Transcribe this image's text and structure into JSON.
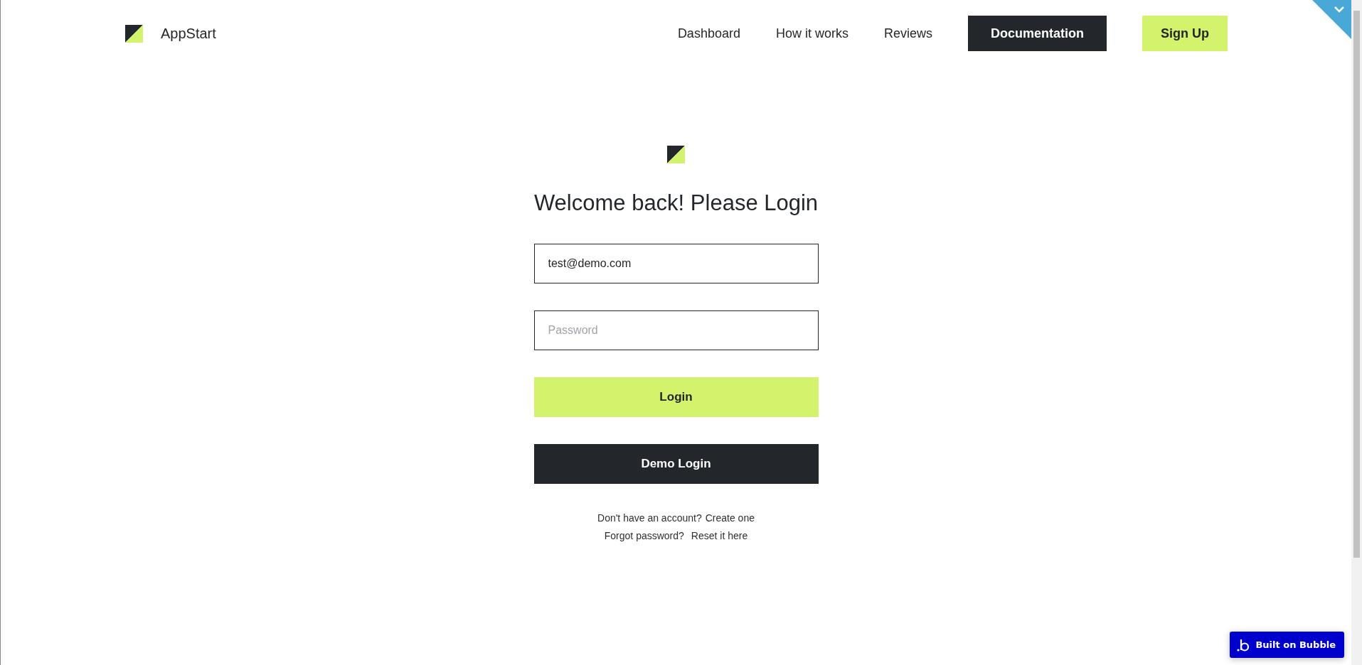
{
  "header": {
    "brand": "AppStart",
    "nav": [
      {
        "label": "Dashboard",
        "kind": "link"
      },
      {
        "label": "How it works",
        "kind": "link"
      },
      {
        "label": "Reviews",
        "kind": "link"
      },
      {
        "label": "Documentation",
        "kind": "dark"
      },
      {
        "label": "Sign Up",
        "kind": "accent"
      }
    ]
  },
  "login": {
    "title": "Welcome back! Please Login",
    "email": {
      "value": "test@demo.com"
    },
    "password": {
      "placeholder": "Password"
    },
    "buttons": [
      {
        "label": "Login",
        "kind": "accent"
      },
      {
        "label": "Demo Login",
        "kind": "dark"
      }
    ],
    "signup_prompt": {
      "text": "Don't have an account?",
      "link": "Create one"
    },
    "reset_prompt": {
      "text": "Forgot password?",
      "link": "Reset it here"
    }
  },
  "badge": {
    "label": "Built on Bubble"
  }
}
